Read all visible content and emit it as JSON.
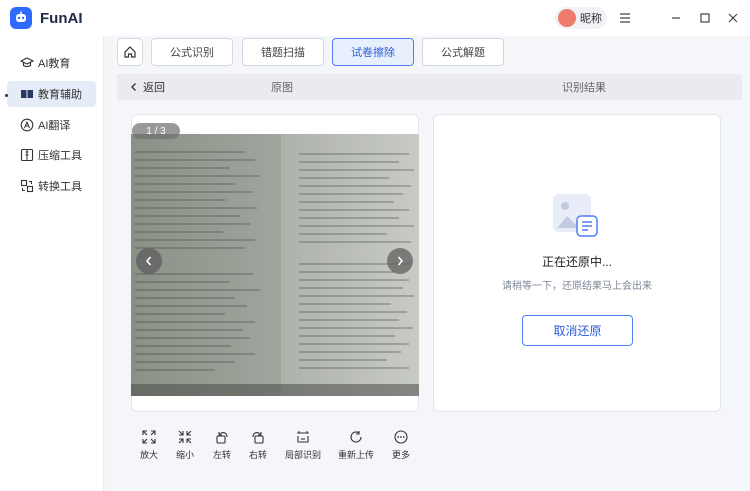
{
  "app": {
    "name": "FunAI",
    "user_nickname": "昵称"
  },
  "sidebar": {
    "items": [
      {
        "label": "AI教育",
        "icon": "graduation-cap-icon",
        "active": false
      },
      {
        "label": "教育辅助",
        "icon": "open-book-icon",
        "active": true
      },
      {
        "label": "AI翻译",
        "icon": "translate-icon",
        "active": false
      },
      {
        "label": "压缩工具",
        "icon": "compress-icon",
        "active": false
      },
      {
        "label": "转换工具",
        "icon": "convert-icon",
        "active": false
      }
    ]
  },
  "tabs": [
    {
      "label": "公式识别",
      "active": false
    },
    {
      "label": "错题扫描",
      "active": false
    },
    {
      "label": "试卷擦除",
      "active": true
    },
    {
      "label": "公式解题",
      "active": false
    }
  ],
  "subbar": {
    "back_label": "返回",
    "original_label": "原图",
    "result_label": "识别结果"
  },
  "viewer": {
    "page_indicator": "1 / 3"
  },
  "toolbar": [
    {
      "label": "放大",
      "icon": "expand-icon"
    },
    {
      "label": "缩小",
      "icon": "shrink-icon"
    },
    {
      "label": "左转",
      "icon": "rotate-left-icon"
    },
    {
      "label": "右转",
      "icon": "rotate-right-icon"
    },
    {
      "label": "局部识别",
      "icon": "crop-icon"
    },
    {
      "label": "重新上传",
      "icon": "reload-icon"
    },
    {
      "label": "更多",
      "icon": "more-icon"
    }
  ],
  "result": {
    "status_title": "正在还原中...",
    "status_subtitle": "请稍等一下，还原结果马上会出来",
    "cancel_label": "取消还原"
  },
  "colors": {
    "accent": "#2f6bff",
    "active_tab_bg": "#e8effd",
    "sidebar_active_bg": "#e6ecf7"
  }
}
